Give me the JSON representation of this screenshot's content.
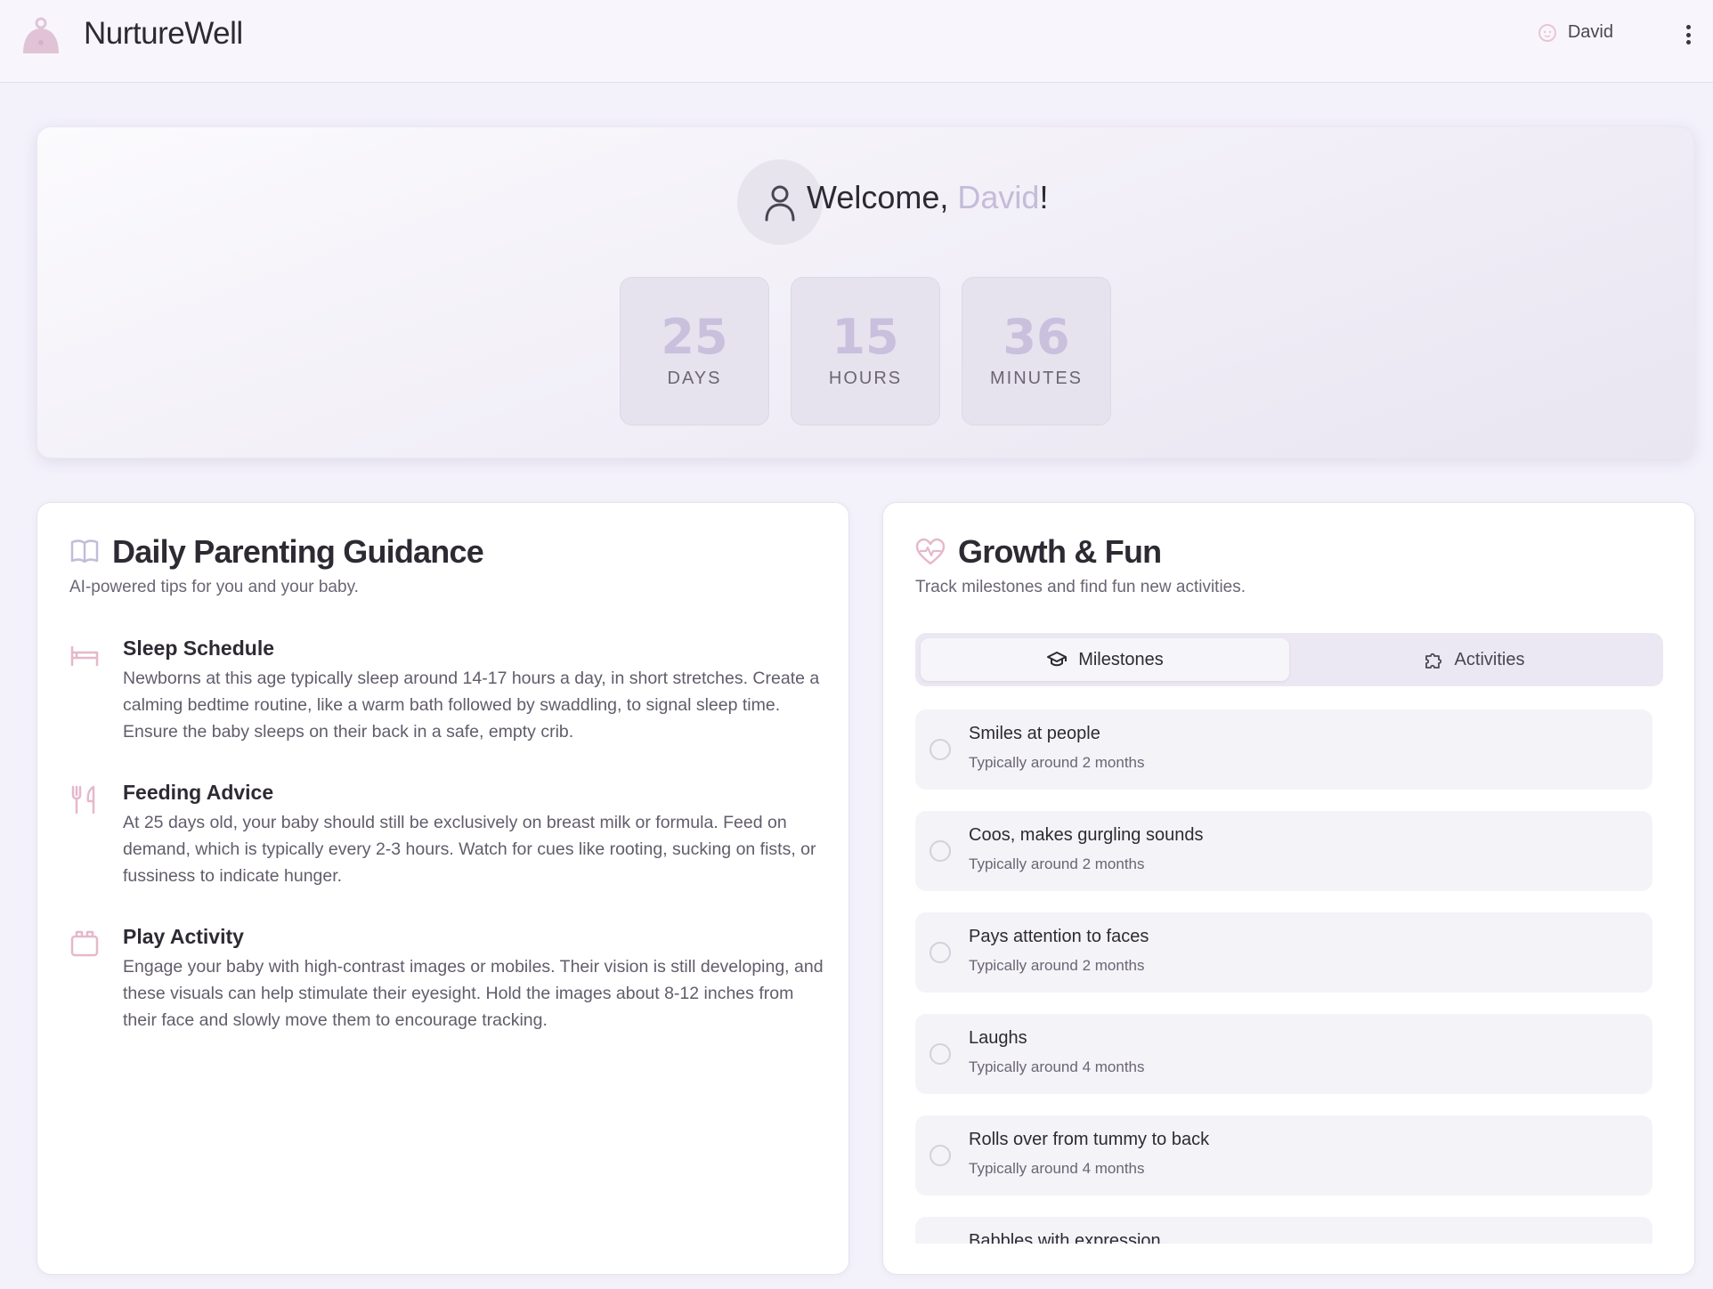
{
  "app": {
    "title": "NurtureWell"
  },
  "header": {
    "user_name": "David"
  },
  "welcome": {
    "greeting": "Welcome, ",
    "name": "David",
    "suffix": "!",
    "counters": [
      {
        "value": "25",
        "label": "DAYS"
      },
      {
        "value": "15",
        "label": "HOURS"
      },
      {
        "value": "36",
        "label": "MINUTES"
      }
    ]
  },
  "guidance": {
    "title": "Daily Parenting Guidance",
    "subtitle": "AI-powered tips for you and your baby.",
    "tips": [
      {
        "icon": "bed-icon",
        "title": "Sleep Schedule",
        "body": "Newborns at this age typically sleep around 14-17 hours a day, in short stretches. Create a calming bedtime routine, like a warm bath followed by swaddling, to signal sleep time. Ensure the baby sleeps on their back in a safe, empty crib."
      },
      {
        "icon": "utensils-icon",
        "title": "Feeding Advice",
        "body": "At 25 days old, your baby should still be exclusively on breast milk or formula. Feed on demand, which is typically every 2-3 hours. Watch for cues like rooting, sucking on fists, or fussiness to indicate hunger."
      },
      {
        "icon": "toy-blocks-icon",
        "title": "Play Activity",
        "body": "Engage your baby with high-contrast images or mobiles. Their vision is still developing, and these visuals can help stimulate their eyesight. Hold the images about 8-12 inches from their face and slowly move them to encourage tracking."
      }
    ]
  },
  "growth": {
    "title": "Growth & Fun",
    "subtitle": "Track milestones and find fun new activities.",
    "tabs": [
      {
        "label": "Milestones",
        "icon": "graduation-cap-icon",
        "active": true
      },
      {
        "label": "Activities",
        "icon": "puzzle-icon",
        "active": false
      }
    ],
    "milestones": [
      {
        "title": "Smiles at people",
        "age": "Typically around 2 months",
        "checked": false
      },
      {
        "title": "Coos, makes gurgling sounds",
        "age": "Typically around 2 months",
        "checked": false
      },
      {
        "title": "Pays attention to faces",
        "age": "Typically around 2 months",
        "checked": false
      },
      {
        "title": "Laughs",
        "age": "Typically around 4 months",
        "checked": false
      },
      {
        "title": "Rolls over from tummy to back",
        "age": "Typically around 4 months",
        "checked": false
      },
      {
        "title": "Babbles with expression",
        "age": "",
        "checked": false
      }
    ]
  },
  "colors": {
    "accent": "#c4bcd9",
    "icon_pink": "#e6b8cc",
    "background": "#f3f1fa"
  }
}
